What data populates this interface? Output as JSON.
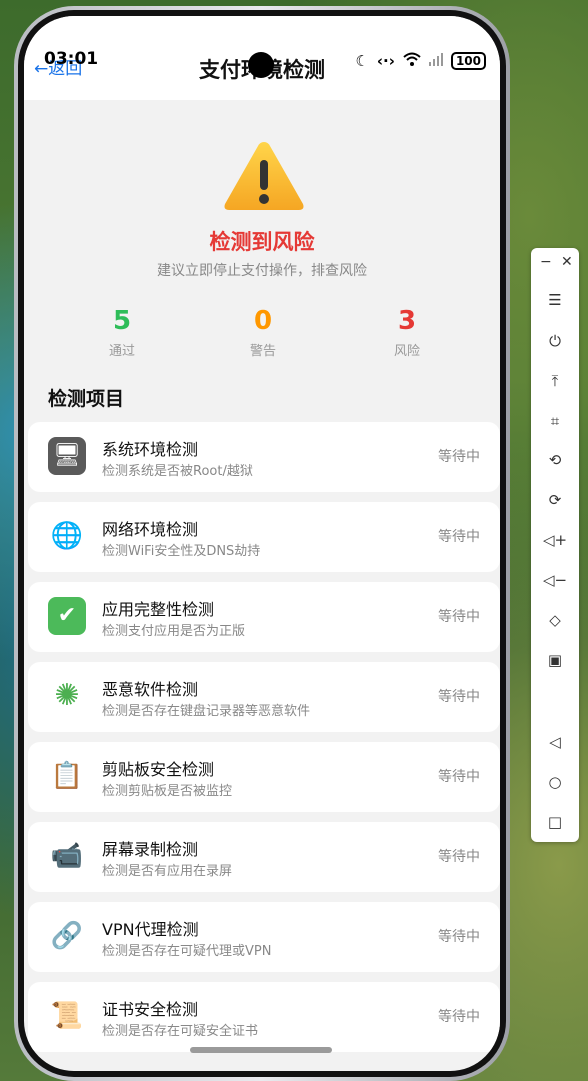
{
  "status_bar": {
    "time": "03:01",
    "battery": "100"
  },
  "header": {
    "back_label": "←返回",
    "title": "支付环境检测"
  },
  "result": {
    "title": "检测到风险",
    "subtitle": "建议立即停止支付操作，排查风险",
    "stats": [
      {
        "value": "5",
        "label": "通过",
        "color": "#2ebd59"
      },
      {
        "value": "0",
        "label": "警告",
        "color": "#ff9800"
      },
      {
        "value": "3",
        "label": "风险",
        "color": "#e53935"
      }
    ]
  },
  "section_title": "检测项目",
  "items": [
    {
      "icon": "monitor-icon",
      "glyph": "🖥",
      "name": "系统环境检测",
      "desc": "检测系统是否被Root/越狱",
      "status": "等待中"
    },
    {
      "icon": "globe-icon",
      "glyph": "🌐",
      "name": "网络环境检测",
      "desc": "检测WiFi安全性及DNS劫持",
      "status": "等待中"
    },
    {
      "icon": "check-icon",
      "glyph": "✔",
      "name": "应用完整性检测",
      "desc": "检测支付应用是否为正版",
      "status": "等待中"
    },
    {
      "icon": "virus-icon",
      "glyph": "✺",
      "name": "恶意软件检测",
      "desc": "检测是否存在键盘记录器等恶意软件",
      "status": "等待中"
    },
    {
      "icon": "clipboard-icon",
      "glyph": "📋",
      "name": "剪贴板安全检测",
      "desc": "检测剪贴板是否被监控",
      "status": "等待中"
    },
    {
      "icon": "video-camera-icon",
      "glyph": "📹",
      "name": "屏幕录制检测",
      "desc": "检测是否有应用在录屏",
      "status": "等待中"
    },
    {
      "icon": "link-icon",
      "glyph": "🔗",
      "name": "VPN代理检测",
      "desc": "检测是否存在可疑代理或VPN",
      "status": "等待中"
    },
    {
      "icon": "scroll-icon",
      "glyph": "📜",
      "name": "证书安全检测",
      "desc": "检测是否存在可疑安全证书",
      "status": "等待中"
    }
  ],
  "toolbar": {
    "buttons": [
      {
        "icon": "menu-icon",
        "glyph": "☰"
      },
      {
        "icon": "power-icon",
        "glyph": "⏻"
      },
      {
        "icon": "upload-icon",
        "glyph": "⤒"
      },
      {
        "icon": "crop-icon",
        "glyph": "⌗"
      },
      {
        "icon": "rotate-left-icon",
        "glyph": "⟲"
      },
      {
        "icon": "rotate-right-icon",
        "glyph": "⟳"
      },
      {
        "icon": "volume-up-icon",
        "glyph": "◁+"
      },
      {
        "icon": "volume-down-icon",
        "glyph": "◁−"
      },
      {
        "icon": "shake-icon",
        "glyph": "◇"
      },
      {
        "icon": "screenshot-icon",
        "glyph": "▣"
      },
      {
        "icon": "nav-back-icon",
        "glyph": "◁"
      },
      {
        "icon": "nav-home-icon",
        "glyph": "○"
      },
      {
        "icon": "nav-recents-icon",
        "glyph": "□"
      }
    ]
  }
}
